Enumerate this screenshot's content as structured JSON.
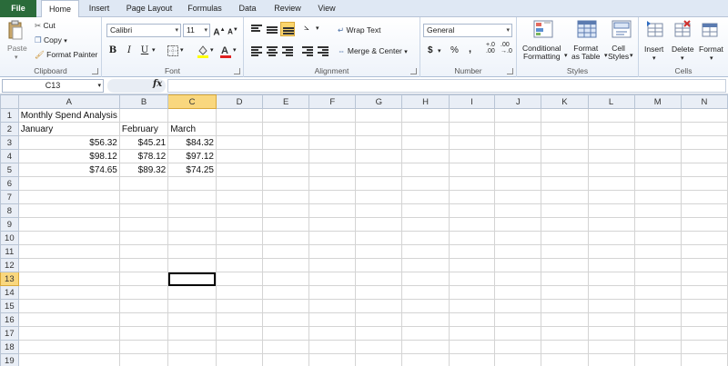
{
  "tabs": [
    "File",
    "Home",
    "Insert",
    "Page Layout",
    "Formulas",
    "Data",
    "Review",
    "View"
  ],
  "ribbon": {
    "clipboard": {
      "paste": "Paste",
      "cut": "Cut",
      "copy": "Copy",
      "format_painter": "Format Painter",
      "label": "Clipboard"
    },
    "font": {
      "name": "Calibri",
      "size": "11",
      "label": "Font"
    },
    "alignment": {
      "wrap_text": "Wrap Text",
      "merge_center": "Merge & Center",
      "label": "Alignment"
    },
    "number": {
      "format": "General",
      "percent": "%",
      "comma": ",",
      "inc_dec": ".0 .00",
      "label": "Number"
    },
    "styles": {
      "conditional": "Conditional",
      "conditional2": "Formatting",
      "format_table": "Format",
      "format_table2": "as Table",
      "cell_styles": "Cell",
      "cell_styles2": "Styles",
      "label": "Styles"
    },
    "cells": {
      "insert": "Insert",
      "delete": "Delete",
      "format": "Format",
      "label": "Cells"
    }
  },
  "formula_bar": {
    "name_box": "C13",
    "fx": "fx",
    "value": ""
  },
  "columns": [
    "A",
    "B",
    "C",
    "D",
    "E",
    "F",
    "G",
    "H",
    "I",
    "J",
    "K",
    "L",
    "M",
    "N"
  ],
  "rows": [
    "1",
    "2",
    "3",
    "4",
    "5",
    "6",
    "7",
    "8",
    "9",
    "10",
    "11",
    "12",
    "13",
    "14",
    "15",
    "16",
    "17",
    "18",
    "19"
  ],
  "cells": {
    "A1": "Monthly Spend Analysis",
    "A2": "January",
    "B2": "February",
    "C2": "March",
    "A3": "$56.32",
    "B3": "$45.21",
    "C3": "$84.32",
    "A4": "$98.12",
    "B4": "$78.12",
    "C4": "$97.12",
    "A5": "$74.65",
    "B5": "$89.32",
    "C5": "$74.25"
  },
  "selected": {
    "cell": "C13",
    "col": "C",
    "row": "13"
  }
}
